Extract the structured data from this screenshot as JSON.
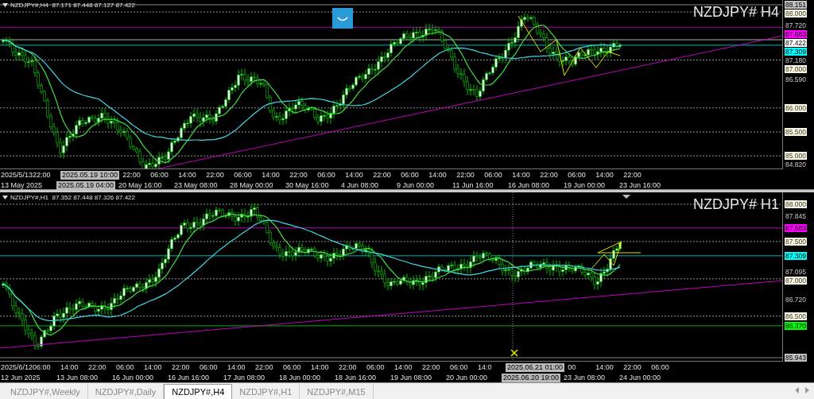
{
  "charts": [
    {
      "header": "NZDJPY#,H4  87.171 87.448 87.127 87.422",
      "title": "NZDJPY# H4",
      "price_axis": [
        {
          "text": "88.151",
          "kind": "line",
          "color": "#c0c0c0"
        },
        {
          "text": "88.000",
          "kind": "level",
          "color": "#fffbe0"
        },
        {
          "text": "87.720",
          "kind": "tick"
        },
        {
          "text": "87.683",
          "kind": "line",
          "color": "#ff00ff"
        },
        {
          "text": "87.422",
          "kind": "line",
          "color": "#ffffff"
        },
        {
          "text": "87.309",
          "kind": "line",
          "color": "#00ffff"
        },
        {
          "text": "87.180",
          "kind": "tick"
        },
        {
          "text": "87.000",
          "kind": "level",
          "color": "#fffbe0"
        },
        {
          "text": "86.590",
          "kind": "tick"
        },
        {
          "text": "86.000",
          "kind": "level",
          "color": "#fffbe0"
        },
        {
          "text": "85.500",
          "kind": "level",
          "color": "#fffbe0"
        },
        {
          "text": "85.000",
          "kind": "level",
          "color": "#fffbe0"
        },
        {
          "text": "84.820",
          "kind": "tick"
        }
      ],
      "time_upper": [
        {
          "text": "2025/5/13",
          "highlighted": false
        },
        {
          "text": "22:00",
          "highlighted": false
        },
        {
          "text": "2025.05.19 10:00",
          "highlighted": true
        },
        {
          "text": "22:00",
          "highlighted": false
        },
        {
          "text": "06:00",
          "highlighted": false
        },
        {
          "text": "14:00",
          "highlighted": false
        },
        {
          "text": "22:00",
          "highlighted": false
        },
        {
          "text": "06:00",
          "highlighted": false
        },
        {
          "text": "14:00",
          "highlighted": false
        },
        {
          "text": "22:00",
          "highlighted": false
        },
        {
          "text": "06:00",
          "highlighted": false
        },
        {
          "text": "14:00",
          "highlighted": false
        },
        {
          "text": "22:00",
          "highlighted": false
        },
        {
          "text": "06:00",
          "highlighted": false
        },
        {
          "text": "14:00",
          "highlighted": false
        },
        {
          "text": "22:00",
          "highlighted": false
        },
        {
          "text": "06:00",
          "highlighted": false
        },
        {
          "text": "14:00",
          "highlighted": false
        },
        {
          "text": "22:00",
          "highlighted": false
        },
        {
          "text": "06:00",
          "highlighted": false
        },
        {
          "text": "14:00",
          "highlighted": false
        },
        {
          "text": "22:00",
          "highlighted": false
        }
      ],
      "time_lower": [
        {
          "text": "13 May 2025",
          "highlighted": false
        },
        {
          "text": "2025.05.19 04:00",
          "highlighted": true
        },
        {
          "text": "20 May 16:00",
          "highlighted": false
        },
        {
          "text": "23 May 08:00",
          "highlighted": false
        },
        {
          "text": "28 May 00:00",
          "highlighted": false
        },
        {
          "text": "30 May 16:00",
          "highlighted": false
        },
        {
          "text": "4 Jun 08:00",
          "highlighted": false
        },
        {
          "text": "9 Jun 00:00",
          "highlighted": false
        },
        {
          "text": "11 Jun 16:00",
          "highlighted": false
        },
        {
          "text": "16 Jun 08:00",
          "highlighted": false
        },
        {
          "text": "19 Jun 00:00",
          "highlighted": false
        },
        {
          "text": "23 Jun 16:00",
          "highlighted": false
        }
      ]
    },
    {
      "header": "NZDJPY#,H1  87.352 87.448 87.326 87.422",
      "title": "NZDJPY# H1",
      "price_axis": [
        {
          "text": "88.000",
          "kind": "level",
          "color": "#fffbe0"
        },
        {
          "text": "87.845",
          "kind": "tick"
        },
        {
          "text": "87.683",
          "kind": "line",
          "color": "#ff00ff"
        },
        {
          "text": "87.500",
          "kind": "level",
          "color": "#fffbe0"
        },
        {
          "text": "87.309",
          "kind": "line",
          "color": "#00ffff"
        },
        {
          "text": "87.095",
          "kind": "tick"
        },
        {
          "text": "87.000",
          "kind": "level",
          "color": "#fffbe0"
        },
        {
          "text": "86.720",
          "kind": "tick"
        },
        {
          "text": "86.500",
          "kind": "level",
          "color": "#fffbe0"
        },
        {
          "text": "86.370",
          "kind": "line",
          "color": "#00ff00"
        },
        {
          "text": "85.943",
          "kind": "line",
          "color": "#c0c0c0"
        }
      ],
      "time_upper": [
        {
          "text": "2025/6/12",
          "highlighted": false
        },
        {
          "text": "06:00",
          "highlighted": false
        },
        {
          "text": "14:00",
          "highlighted": false
        },
        {
          "text": "22:00",
          "highlighted": false
        },
        {
          "text": "06:00",
          "highlighted": false
        },
        {
          "text": "14:00",
          "highlighted": false
        },
        {
          "text": "22:00",
          "highlighted": false
        },
        {
          "text": "06:00",
          "highlighted": false
        },
        {
          "text": "14:00",
          "highlighted": false
        },
        {
          "text": "22:00",
          "highlighted": false
        },
        {
          "text": "06:00",
          "highlighted": false
        },
        {
          "text": "14:00",
          "highlighted": false
        },
        {
          "text": "22:00",
          "highlighted": false
        },
        {
          "text": "06:00",
          "highlighted": false
        },
        {
          "text": "14:00",
          "highlighted": false
        },
        {
          "text": "22:00",
          "highlighted": false
        },
        {
          "text": "06:00",
          "highlighted": false
        },
        {
          "text": "14:0",
          "highlighted": false
        },
        {
          "text": "2025.06.21 01:00",
          "highlighted": true
        },
        {
          "text": "00",
          "highlighted": false
        },
        {
          "text": "14:00",
          "highlighted": false
        },
        {
          "text": "22:00",
          "highlighted": false
        },
        {
          "text": "06:00",
          "highlighted": false
        }
      ],
      "time_lower": [
        {
          "text": "12 Jun 2025",
          "highlighted": false
        },
        {
          "text": "13 Jun 08:00",
          "highlighted": false
        },
        {
          "text": "16 Jun 00:00",
          "highlighted": false
        },
        {
          "text": "16 Jun 16:00",
          "highlighted": false
        },
        {
          "text": "17 Jun 08:00",
          "highlighted": false
        },
        {
          "text": "18 Jun 00:00",
          "highlighted": false
        },
        {
          "text": "18 Jun 16:00",
          "highlighted": false
        },
        {
          "text": "19 Jun 08:00",
          "highlighted": false
        },
        {
          "text": "20 Jun 00:00",
          "highlighted": false
        },
        {
          "text": "2025.06.20 19:00",
          "highlighted": true
        },
        {
          "text": "23 Jun 08:00",
          "highlighted": false
        },
        {
          "text": "24 Jun 00:00",
          "highlighted": false
        }
      ]
    }
  ],
  "tabs": [
    {
      "label": "NZDJPY#,Weekly",
      "selected": false
    },
    {
      "label": "NZDJPY#,Daily",
      "selected": false
    },
    {
      "label": "NZDJPY#,H4",
      "selected": true
    },
    {
      "label": "NZDJPY#,H1",
      "selected": false
    },
    {
      "label": "NZDJPY#,M15",
      "selected": false
    }
  ]
}
